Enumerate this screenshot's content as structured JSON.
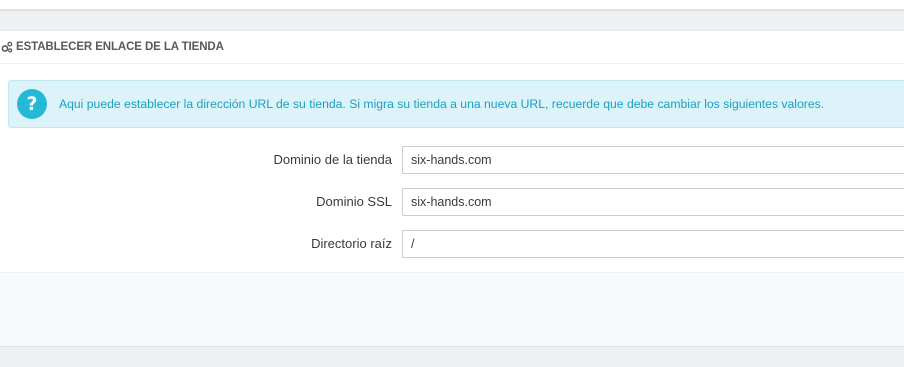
{
  "section": {
    "title": "ESTABLECER ENLACE DE LA TIENDA",
    "icon": "cogs-icon"
  },
  "alert": {
    "icon": "question-circle-icon",
    "text": "Aqui puede establecer la dirección URL de su tienda. Si migra su tienda a una nueva URL, recuerde que debe cambiar los siguientes valores."
  },
  "fields": {
    "shop_domain": {
      "label": "Dominio de la tienda",
      "value": "six-hands.com"
    },
    "ssl_domain": {
      "label": "Dominio SSL",
      "value": "six-hands.com"
    },
    "base_uri": {
      "label": "Directorio raíz",
      "value": "/"
    }
  },
  "colors": {
    "accent": "#25b9d7",
    "alert_bg": "#dcf4f9",
    "alert_text": "#1a9fc4",
    "heading_text": "#555a60"
  }
}
